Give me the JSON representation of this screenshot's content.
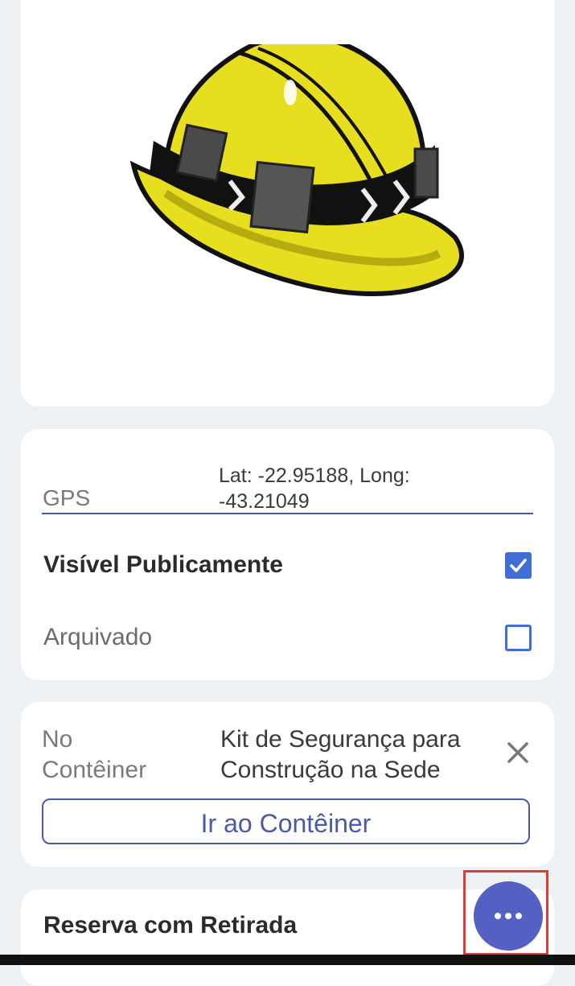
{
  "image_card": {
    "alt": "hard-hat-image"
  },
  "properties": {
    "gps_label": "GPS",
    "gps_value_line1": "Lat: -22.95188, Long:",
    "gps_value_line2": "-43.21049",
    "public_label": "Visível Publicamente",
    "public_checked": true,
    "archived_label": "Arquivado",
    "archived_checked": false
  },
  "container": {
    "label_line1": "No",
    "label_line2": "Contêiner",
    "value_line1": "Kit de Segurança para",
    "value_line2": "Construção na Sede",
    "go_button": "Ir ao Contêiner"
  },
  "reservation": {
    "label": "Reserva com Retirada"
  },
  "colors": {
    "accent": "#4a5aa8",
    "checkbox": "#3f6fd6",
    "fab": "#5560c4",
    "highlight": "#e53935"
  }
}
